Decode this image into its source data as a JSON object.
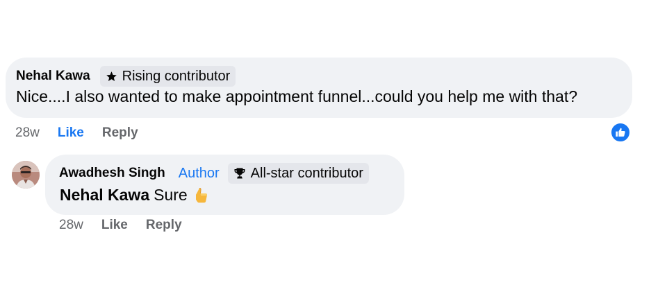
{
  "comments": [
    {
      "author": "Nehal Kawa",
      "badge": "Rising contributor",
      "badge_icon": "star-badge-icon",
      "text": "Nice....I also wanted to make appointment funnel...could you help me with that?",
      "time": "28w",
      "like_label": "Like",
      "reply_label": "Reply",
      "liked": true,
      "reaction_icon": "like-reaction-icon"
    },
    {
      "author": "Awadhesh Singh",
      "author_tag": "Author",
      "badge": "All-star contributor",
      "badge_icon": "trophy-icon",
      "mention": "Nehal Kawa",
      "text": "Sure",
      "emoji": "thumbs-up-emoji",
      "time": "28w",
      "like_label": "Like",
      "reply_label": "Reply"
    }
  ],
  "colors": {
    "accent": "#1877f2",
    "bubble": "#f0f2f5",
    "badge_bg": "#e4e6eb",
    "muted_text": "#65676b",
    "text": "#050505"
  }
}
